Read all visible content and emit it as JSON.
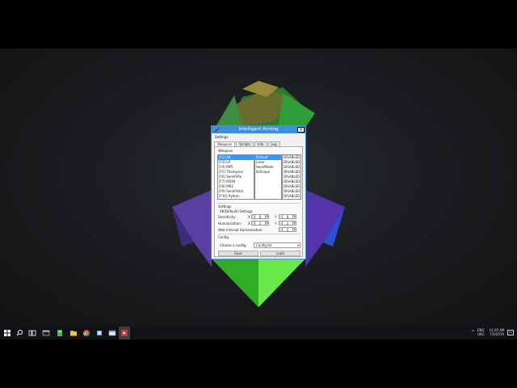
{
  "window": {
    "title": "Intelligent Aiming",
    "menu": [
      "Settings"
    ],
    "tabs": [
      "Weapons",
      "Scripts",
      "Info",
      "Log"
    ],
    "active_tab": "Weapons"
  },
  "weapons": {
    "heading": "Weapons",
    "keys_list": [
      "[F2] AK",
      "[F3] LR",
      "[F4] MP5",
      "[F5] Thompson",
      "[F6] SemiRifle",
      "[F7] M249",
      "[F8] MR2",
      "[F9] SemiPistol",
      "[F10] Python"
    ],
    "selected_key": "[F2] AK",
    "scripts_list": [
      "Default",
      "Laser",
      "HandMade",
      "8xScope"
    ],
    "selected_script": "Default",
    "status_list": [
      "DISABLED",
      "DISABLED",
      "DISABLED",
      "DISABLED",
      "DISABLED",
      "DISABLED",
      "DISABLED",
      "DISABLED",
      "DISABLED"
    ]
  },
  "settings": {
    "heading": "Settings",
    "subheading": "AK(Default) Settings",
    "sensitivity": {
      "label": "Sensitivity:",
      "x_label": "X",
      "x": "0",
      "y_label": "Y",
      "y": "0"
    },
    "humanization": {
      "label": "Humanization:",
      "x_label": "X",
      "x": "2",
      "y_label": "Y",
      "y": "2"
    },
    "wait": {
      "label": "Wait Interval Humanization:",
      "value": "2"
    }
  },
  "config": {
    "heading": "Config",
    "choose_label": "Choose a config:",
    "selected": "Config.txt",
    "save_label": "Save",
    "load_label": "Load"
  },
  "taskbar": {
    "icons": [
      "windows-start-icon",
      "search-icon",
      "task-view-icon",
      "terminal-icon",
      "file-manager-icon",
      "file-explorer-icon",
      "chrome-icon",
      "app-icon",
      "window-icon",
      "media-icon"
    ],
    "lang_top": "ENG",
    "lang_bottom": "UKG",
    "time": "12:05 AM",
    "date": "7/3/2019"
  }
}
